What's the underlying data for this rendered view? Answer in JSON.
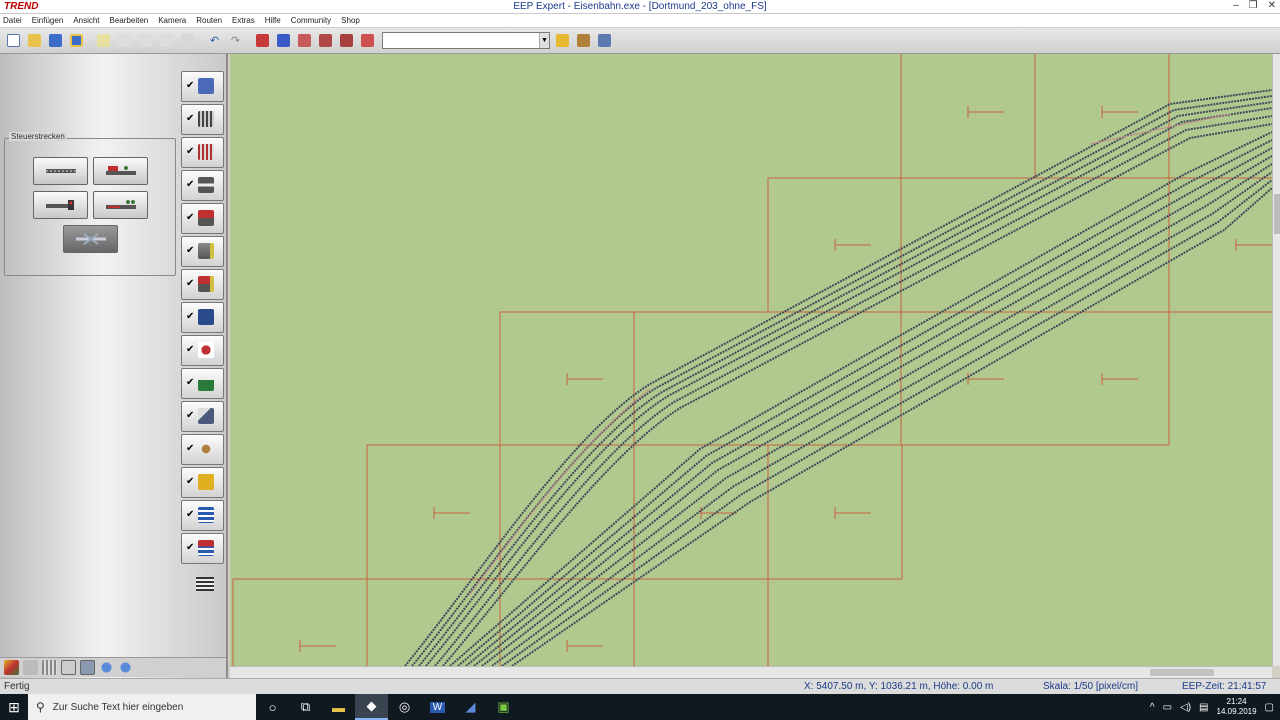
{
  "window": {
    "logo": "TREND",
    "title": "EEP Expert - Eisenbahn.exe - [Dortmund_203_ohne_FS]",
    "min": "–",
    "max": "❐",
    "close": "✕"
  },
  "menu": [
    "Datei",
    "Einfügen",
    "Ansicht",
    "Bearbeiten",
    "Kamera",
    "Routen",
    "Extras",
    "Hilfe",
    "Community",
    "Shop"
  ],
  "toolbar": {
    "combo_value": "",
    "combo_arrow": "▼"
  },
  "left_panel": {
    "group_label": "Steuerstrecken",
    "layer_check": "✔"
  },
  "status": {
    "ready": "Fertig",
    "coords": "X: 5407.50 m, Y: 1036.21 m, Höhe: 0.00 m",
    "scale": "Skala: 1/50 [pixel/cm]",
    "time": "EEP-Zeit: 21:41:57"
  },
  "taskbar": {
    "search_placeholder": "Zur Suche Text hier eingeben",
    "time": "21:24",
    "date": "14.09.2019"
  },
  "colors": {
    "canvas": "#b1c98e",
    "grid_lines": "#c8623e",
    "tracks": "#3e4a5c"
  }
}
